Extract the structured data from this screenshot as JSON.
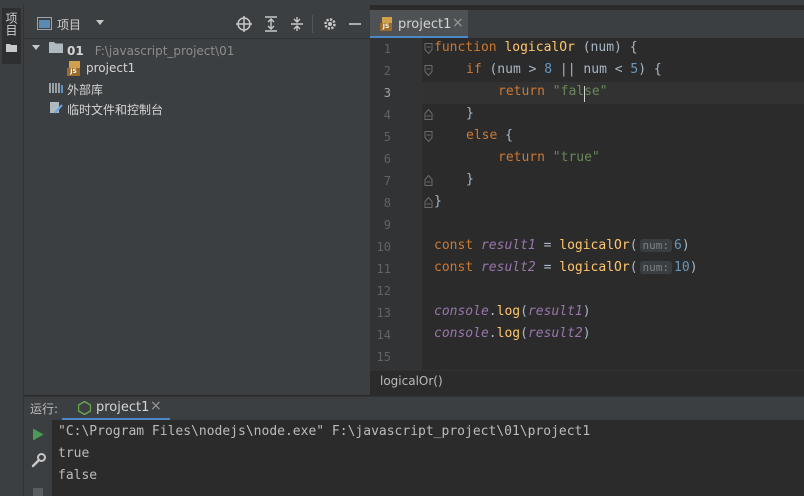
{
  "sidebar_stripe": {
    "label": "项目"
  },
  "project_panel": {
    "title": "项目",
    "tree": {
      "root_name": "01",
      "root_path": "F:\\javascript_project\\01",
      "file": "project1",
      "file_badge": "JS",
      "external_libraries": "外部库",
      "scratches": "临时文件和控制台"
    }
  },
  "editor": {
    "tab": {
      "label": "project1",
      "badge": "JS",
      "close": "×"
    },
    "line_numbers": [
      "1",
      "2",
      "3",
      "4",
      "5",
      "6",
      "7",
      "8",
      "9",
      "10",
      "11",
      "12",
      "13",
      "14",
      "15"
    ],
    "code": {
      "l1": {
        "kw": "function",
        "fn": "logicalOr",
        "rest": " (num) {"
      },
      "l2": {
        "kw": "if",
        "a": " (num > ",
        "n1": "8",
        "b": " || num < ",
        "n2": "5",
        "c": ") {"
      },
      "l3": {
        "kw": "return",
        "str": " \"false\""
      },
      "l4": "}",
      "l5": {
        "kw": "else",
        "rest": " {"
      },
      "l6": {
        "kw": "return",
        "str": " \"true\""
      },
      "l7": "}",
      "l8": "}",
      "l10": {
        "kw": "const",
        "var": "result1",
        "eq": " = ",
        "fn": "logicalOr",
        "open": "(",
        "hint": "num:",
        "arg": "6",
        "close": ")"
      },
      "l11": {
        "kw": "const",
        "var": "result2",
        "eq": " = ",
        "fn": "logicalOr",
        "open": "(",
        "hint": "num:",
        "arg": "10",
        "close": ")"
      },
      "l13": {
        "obj": "console",
        "dot": ".",
        "method": "log",
        "open": "(",
        "var": "result1",
        "close": ")"
      },
      "l14": {
        "obj": "console",
        "dot": ".",
        "method": "log",
        "open": "(",
        "var": "result2",
        "close": ")"
      }
    },
    "breadcrumb": "logicalOr()"
  },
  "run_panel": {
    "label": "运行:",
    "tab": "project1",
    "tab_close": "×",
    "console_lines": [
      "\"C:\\Program Files\\nodejs\\node.exe\" F:\\javascript_project\\01\\project1",
      "true",
      "false"
    ]
  },
  "colors": {
    "keyword": "#cc7832",
    "function": "#ffc66d",
    "number": "#6897bb",
    "string": "#6a8759",
    "const_var": "#9876aa",
    "accent": "#4a88c7",
    "run_green": "#499c54"
  },
  "icons": [
    "folder-icon",
    "crosshair-icon",
    "expand-all-icon",
    "collapse-all-icon",
    "gear-icon",
    "minimize-icon",
    "chevron-down-icon",
    "js-file-icon",
    "library-icon",
    "scratches-icon",
    "run-icon",
    "wrench-icon",
    "stop-icon",
    "close-icon",
    "nodejs-icon"
  ]
}
